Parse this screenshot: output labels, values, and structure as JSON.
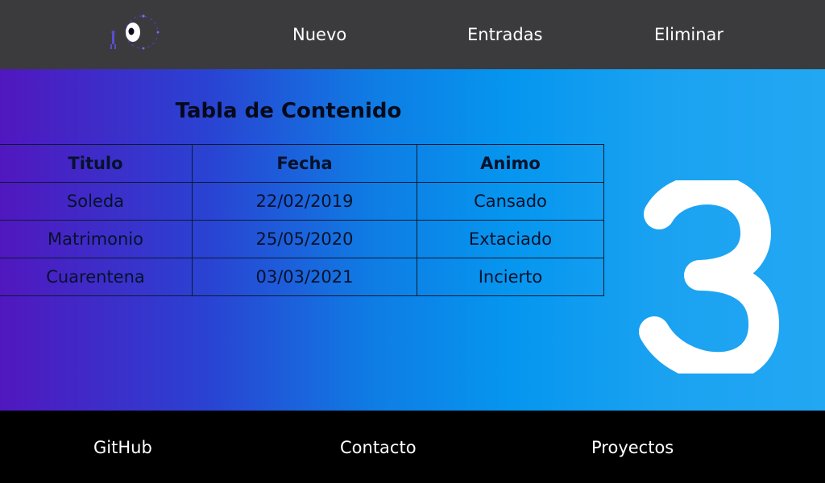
{
  "nav": {
    "items": [
      {
        "label": "Nuevo"
      },
      {
        "label": "Entradas"
      },
      {
        "label": "Eliminar"
      }
    ]
  },
  "main": {
    "table_title": "Tabla de Contenido",
    "table": {
      "headers": [
        "Titulo",
        "Fecha",
        "Animo"
      ],
      "rows": [
        [
          "Soleda",
          "22/02/2019",
          "Cansado"
        ],
        [
          "Matrimonio",
          "25/05/2020",
          "Extaciado"
        ],
        [
          "Cuarentena",
          "03/03/2021",
          "Incierto"
        ]
      ]
    },
    "big_number": "3"
  },
  "footer": {
    "links": [
      {
        "label": "GitHub"
      },
      {
        "label": "Contacto"
      },
      {
        "label": "Proyectos"
      }
    ]
  },
  "colors": {
    "topbar": "#3b3b3d",
    "footer": "#000000",
    "gradient_start": "#5117bf",
    "gradient_end": "#22a7f2",
    "text_light": "#ffffff"
  },
  "icons": {
    "logo": "logo-icon"
  }
}
